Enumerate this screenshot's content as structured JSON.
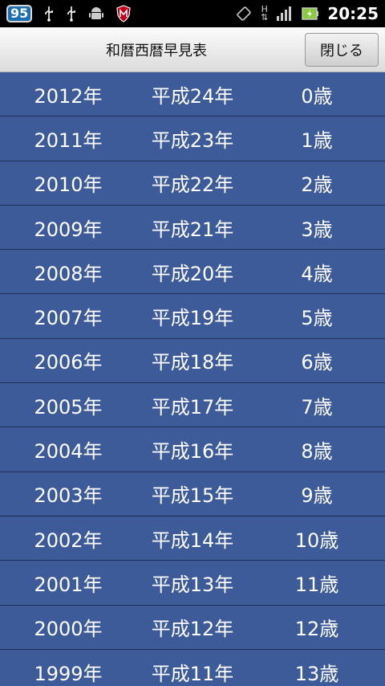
{
  "status_bar": {
    "notification_count": "95",
    "time": "20:25",
    "network_type": "H"
  },
  "title_bar": {
    "title": "和暦西暦早見表",
    "close_label": "閉じる"
  },
  "rows": [
    {
      "western": "2012年",
      "japanese": "平成24年",
      "age": "0歳"
    },
    {
      "western": "2011年",
      "japanese": "平成23年",
      "age": "1歳"
    },
    {
      "western": "2010年",
      "japanese": "平成22年",
      "age": "2歳"
    },
    {
      "western": "2009年",
      "japanese": "平成21年",
      "age": "3歳"
    },
    {
      "western": "2008年",
      "japanese": "平成20年",
      "age": "4歳"
    },
    {
      "western": "2007年",
      "japanese": "平成19年",
      "age": "5歳"
    },
    {
      "western": "2006年",
      "japanese": "平成18年",
      "age": "6歳"
    },
    {
      "western": "2005年",
      "japanese": "平成17年",
      "age": "7歳"
    },
    {
      "western": "2004年",
      "japanese": "平成16年",
      "age": "8歳"
    },
    {
      "western": "2003年",
      "japanese": "平成15年",
      "age": "9歳"
    },
    {
      "western": "2002年",
      "japanese": "平成14年",
      "age": "10歳"
    },
    {
      "western": "2001年",
      "japanese": "平成13年",
      "age": "11歳"
    },
    {
      "western": "2000年",
      "japanese": "平成12年",
      "age": "12歳"
    },
    {
      "western": "1999年",
      "japanese": "平成11年",
      "age": "13歳"
    }
  ],
  "colors": {
    "row_background": "#3d5a99",
    "row_divider": "#1f2f58",
    "row_text": "#ffffff"
  }
}
